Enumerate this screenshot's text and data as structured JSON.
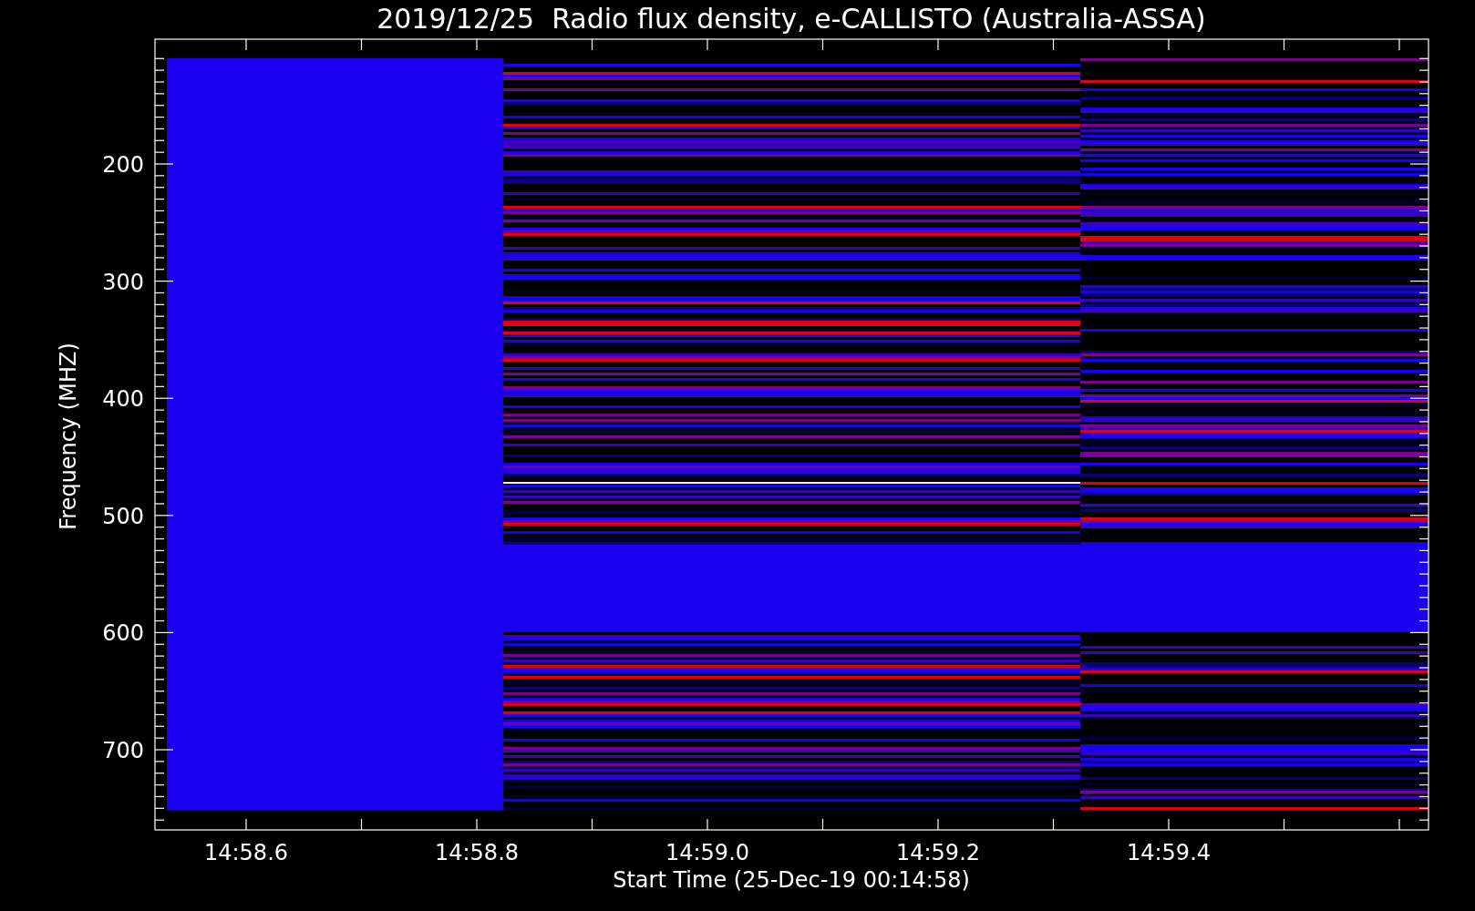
{
  "title": "2019/12/25  Radio flux density, e-CALLISTO (Australia-ASSA)",
  "y_axis": {
    "label": "Frequency (MHZ)",
    "ticks": [
      "200",
      "300",
      "400",
      "500",
      "600",
      "700"
    ]
  },
  "x_axis": {
    "label": "Start Time (25-Dec-19 00:14:58)",
    "ticks": [
      "14:58.6",
      "14:58.8",
      "14:59.0",
      "14:59.2",
      "14:59.4"
    ]
  }
}
